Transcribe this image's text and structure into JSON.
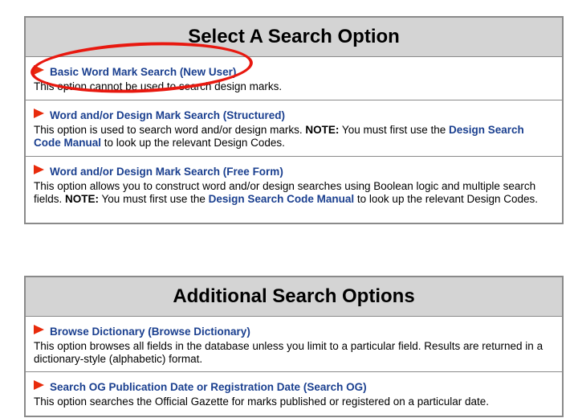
{
  "panel1": {
    "title": "Select A Search Option",
    "options": [
      {
        "link": "Basic Word Mark Search (New User)",
        "desc": "This option cannot be used to search design marks."
      },
      {
        "link": "Word and/or Design Mark Search (Structured)",
        "desc_a": "This option is used to search word and/or design marks. ",
        "note_label": "NOTE:",
        "desc_b": " You must first use the ",
        "inline_link": "Design Search Code Manual",
        "desc_c": " to look up the relevant Design Codes."
      },
      {
        "link": "Word and/or Design Mark Search (Free Form)",
        "desc_a": "This option allows you to construct word and/or design searches using Boolean logic and multiple search fields. ",
        "note_label": "NOTE:",
        "desc_b": " You must first use the ",
        "inline_link": "Design Search Code Manual",
        "desc_c": " to look up the relevant Design Codes."
      }
    ]
  },
  "panel2": {
    "title": "Additional Search Options",
    "options": [
      {
        "link": "Browse Dictionary (Browse Dictionary)",
        "desc": "This option browses all fields in the database unless you limit to a particular field. Results are returned in a dictionary-style (alphabetic) format."
      },
      {
        "link": "Search OG Publication Date or Registration Date (Search OG)",
        "desc": "This option searches the Official Gazette for marks published or registered on a particular date."
      }
    ]
  },
  "colors": {
    "link": "#1a3f8f",
    "flag": "#e82b0c",
    "header_bg": "#d4d4d4",
    "annotation": "#e8180f"
  },
  "icons": {
    "option_bullet": "red-flag-icon"
  }
}
